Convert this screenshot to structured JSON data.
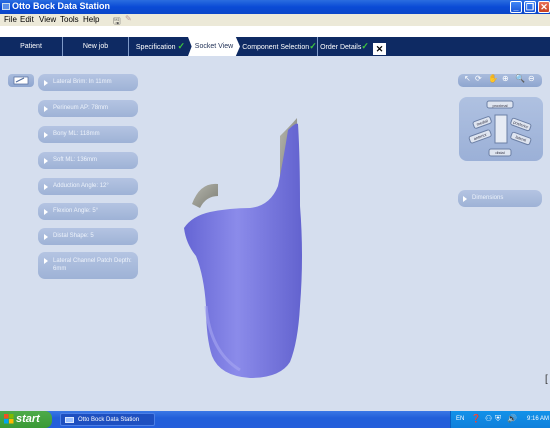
{
  "window": {
    "title": "Otto Bock Data Station"
  },
  "menu": [
    "File",
    "Edit",
    "View",
    "Tools",
    "Help"
  ],
  "tabs": [
    {
      "label": "Patient",
      "done": false,
      "active": false
    },
    {
      "label": "New job",
      "done": false,
      "active": false
    },
    {
      "label": "Specification",
      "done": true,
      "active": false
    },
    {
      "label": "Socket View",
      "done": false,
      "active": true
    },
    {
      "label": "Component Selection",
      "done": true,
      "active": false
    },
    {
      "label": "Order Details",
      "done": true,
      "active": false
    }
  ],
  "checkmark": "✓",
  "close_tab_label": "✕",
  "parameters": [
    "Lateral Brim: In 11mm",
    "Perineum AP: 78mm",
    "Bony ML: 118mm",
    "Soft ML: 136mm",
    "Adduction Angle: 12°",
    "Flexion Angle: 5°",
    "Distal Shape: 5",
    "Lateral Channel Patch Depth: 6mm"
  ],
  "dimensions_label": "Dimensions",
  "orientation_cube": {
    "labels": [
      "proximal",
      "medial",
      "posterior",
      "anterior",
      "lateral",
      "distal"
    ]
  },
  "colors": {
    "socket": "#7b7be0",
    "socket_dark": "#5656c4",
    "inner_surface": "#8e8f86",
    "tab_strip": "#0e2a63",
    "check": "#3ec63e"
  },
  "taskbar": {
    "start_label": "start",
    "task_label": "Otto Bock Data Station",
    "lang": "EN",
    "clock": "9:16 AM"
  }
}
